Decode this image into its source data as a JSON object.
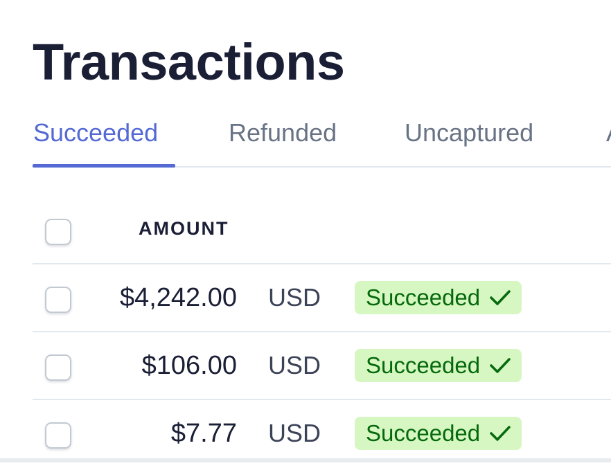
{
  "page": {
    "title": "Transactions"
  },
  "tabs": [
    {
      "label": "Succeeded",
      "active": true
    },
    {
      "label": "Refunded",
      "active": false
    },
    {
      "label": "Uncaptured",
      "active": false
    },
    {
      "label": "A",
      "active": false
    }
  ],
  "table": {
    "columns": {
      "amount": "AMOUNT"
    },
    "rows": [
      {
        "amount": "$4,242.00",
        "currency": "USD",
        "status": "Succeeded"
      },
      {
        "amount": "$106.00",
        "currency": "USD",
        "status": "Succeeded"
      },
      {
        "amount": "$7.77",
        "currency": "USD",
        "status": "Succeeded"
      }
    ]
  },
  "colors": {
    "accent": "#5469d4",
    "text": "#1a1f36",
    "muted": "#697386",
    "success_bg": "#d7f7c2",
    "success_text": "#05690d",
    "border": "#e3e8ee"
  },
  "icons": {
    "status": "check-icon"
  }
}
